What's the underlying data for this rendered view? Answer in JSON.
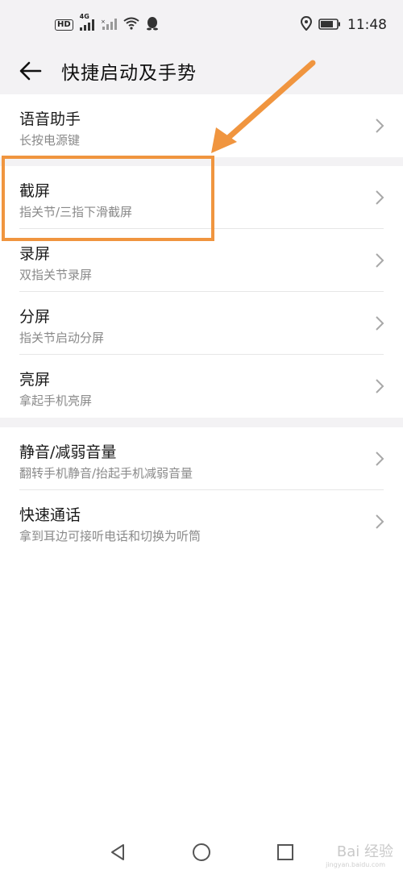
{
  "status_bar": {
    "hd_label": "HD",
    "network_label": "4G",
    "time": "11:48"
  },
  "header": {
    "title": "快捷启动及手势"
  },
  "groups": [
    {
      "items": [
        {
          "title": "语音助手",
          "subtitle": "长按电源键"
        }
      ]
    },
    {
      "items": [
        {
          "title": "截屏",
          "subtitle": "指关节/三指下滑截屏"
        },
        {
          "title": "录屏",
          "subtitle": "双指关节录屏"
        },
        {
          "title": "分屏",
          "subtitle": "指关节启动分屏"
        },
        {
          "title": "亮屏",
          "subtitle": "拿起手机亮屏"
        }
      ]
    },
    {
      "items": [
        {
          "title": "静音/减弱音量",
          "subtitle": "翻转手机静音/抬起手机减弱音量"
        },
        {
          "title": "快速通话",
          "subtitle": "拿到耳边可接听电话和切换为听筒"
        }
      ]
    }
  ],
  "annotation": {
    "color": "#f0953f"
  },
  "watermark": {
    "text": "Bai 经验",
    "sub": "jingyan.baidu.com"
  },
  "icons": [
    "back-arrow-icon",
    "chevron-right-icon",
    "nav-back-icon",
    "nav-home-icon",
    "nav-recents-icon",
    "location-icon",
    "battery-icon",
    "wifi-icon",
    "signal-icon",
    "qq-icon"
  ]
}
